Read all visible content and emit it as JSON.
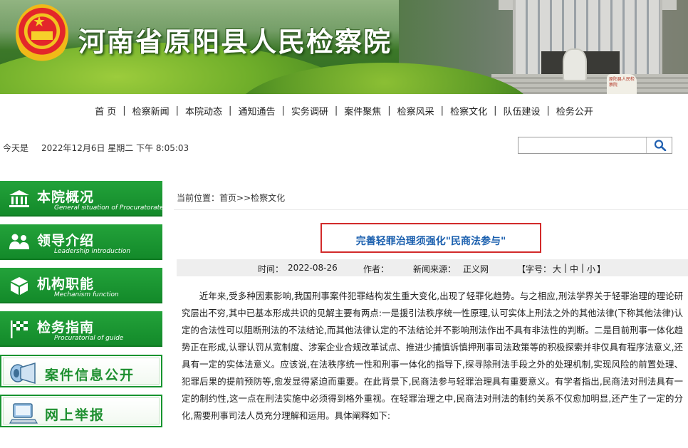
{
  "site": {
    "title": "河南省原阳县人民检察院",
    "stone_text": "原阳县人民检察院"
  },
  "nav": [
    "首 页",
    "检察新闻",
    "本院动态",
    "通知通告",
    "实务调研",
    "案件聚焦",
    "检察风采",
    "检察文化",
    "队伍建设",
    "检务公开"
  ],
  "dateline": {
    "label": "今天是",
    "value": "2022年12月6日 星期二 下午 8:05:03"
  },
  "search": {
    "placeholder": ""
  },
  "sidebar": {
    "green": [
      {
        "title": "本院概况",
        "en": "General situation of Procuratorate",
        "icon": "building-icon"
      },
      {
        "title": "领导介绍",
        "en": "Leadership introduction",
        "icon": "people-icon"
      },
      {
        "title": "机构职能",
        "en": "Mechanism function",
        "icon": "cube-icon"
      },
      {
        "title": "检务指南",
        "en": "Procuratorial of guide",
        "icon": "flag-icon"
      }
    ],
    "white": [
      {
        "title": "案件信息公开",
        "icon": "megaphone-icon"
      },
      {
        "title": "网上举报",
        "icon": "computer-icon"
      }
    ]
  },
  "breadcrumb": {
    "prefix": "当前位置：",
    "home": "首页",
    "sep": ">>",
    "section": "检察文化"
  },
  "article": {
    "title": "完善轻罪治理须强化\"民商法参与\"",
    "time_label": "时间：",
    "time": "2022-08-26",
    "author_label": "作者：",
    "author": "",
    "source_label": "新闻来源：",
    "source": "正义网",
    "font_label": "【字号：",
    "font_large": "大",
    "font_medium": "中",
    "font_small": "小",
    "font_close": "】",
    "font_sep": "|",
    "body": "近年来,受多种因素影响,我国刑事案件犯罪结构发生重大变化,出现了轻罪化趋势。与之相应,刑法学界关于轻罪治理的理论研究层出不穷,其中已基本形成共识的见解主要有两点:一是援引法秩序统一性原理,认可实体上刑法之外的其他法律(下称其他法律)认定的合法性可以阻断刑法的不法结论,而其他法律认定的不法结论并不影响刑法作出不具有非法性的判断。二是目前刑事一体化趋势正在形成,认罪认罚从宽制度、涉案企业合规改革试点、推进少捕慎诉慎押刑事司法政策等的积极探索并非仅具有程序法意义,还具有一定的实体法意义。应该说,在法秩序统一性和刑事一体化的指导下,探寻除刑法手段之外的处理机制,实现风险的前置处理、犯罪后果的提前预防等,愈发显得紧迫而重要。在此背景下,民商法参与轻罪治理具有重要意义。有学者指出,民商法对刑法具有一定的制约性,这一点在刑法实施中必须得到格外重视。在轻罪治理之中,民商法对刑法的制约关系不仅愈加明显,还产生了一定的分化,需要刑事司法人员充分理解和运用。具体阐释如下:"
  },
  "colors": {
    "green": "#138a2a",
    "title_blue": "#1a5fae",
    "box_red": "#d22a2a"
  }
}
